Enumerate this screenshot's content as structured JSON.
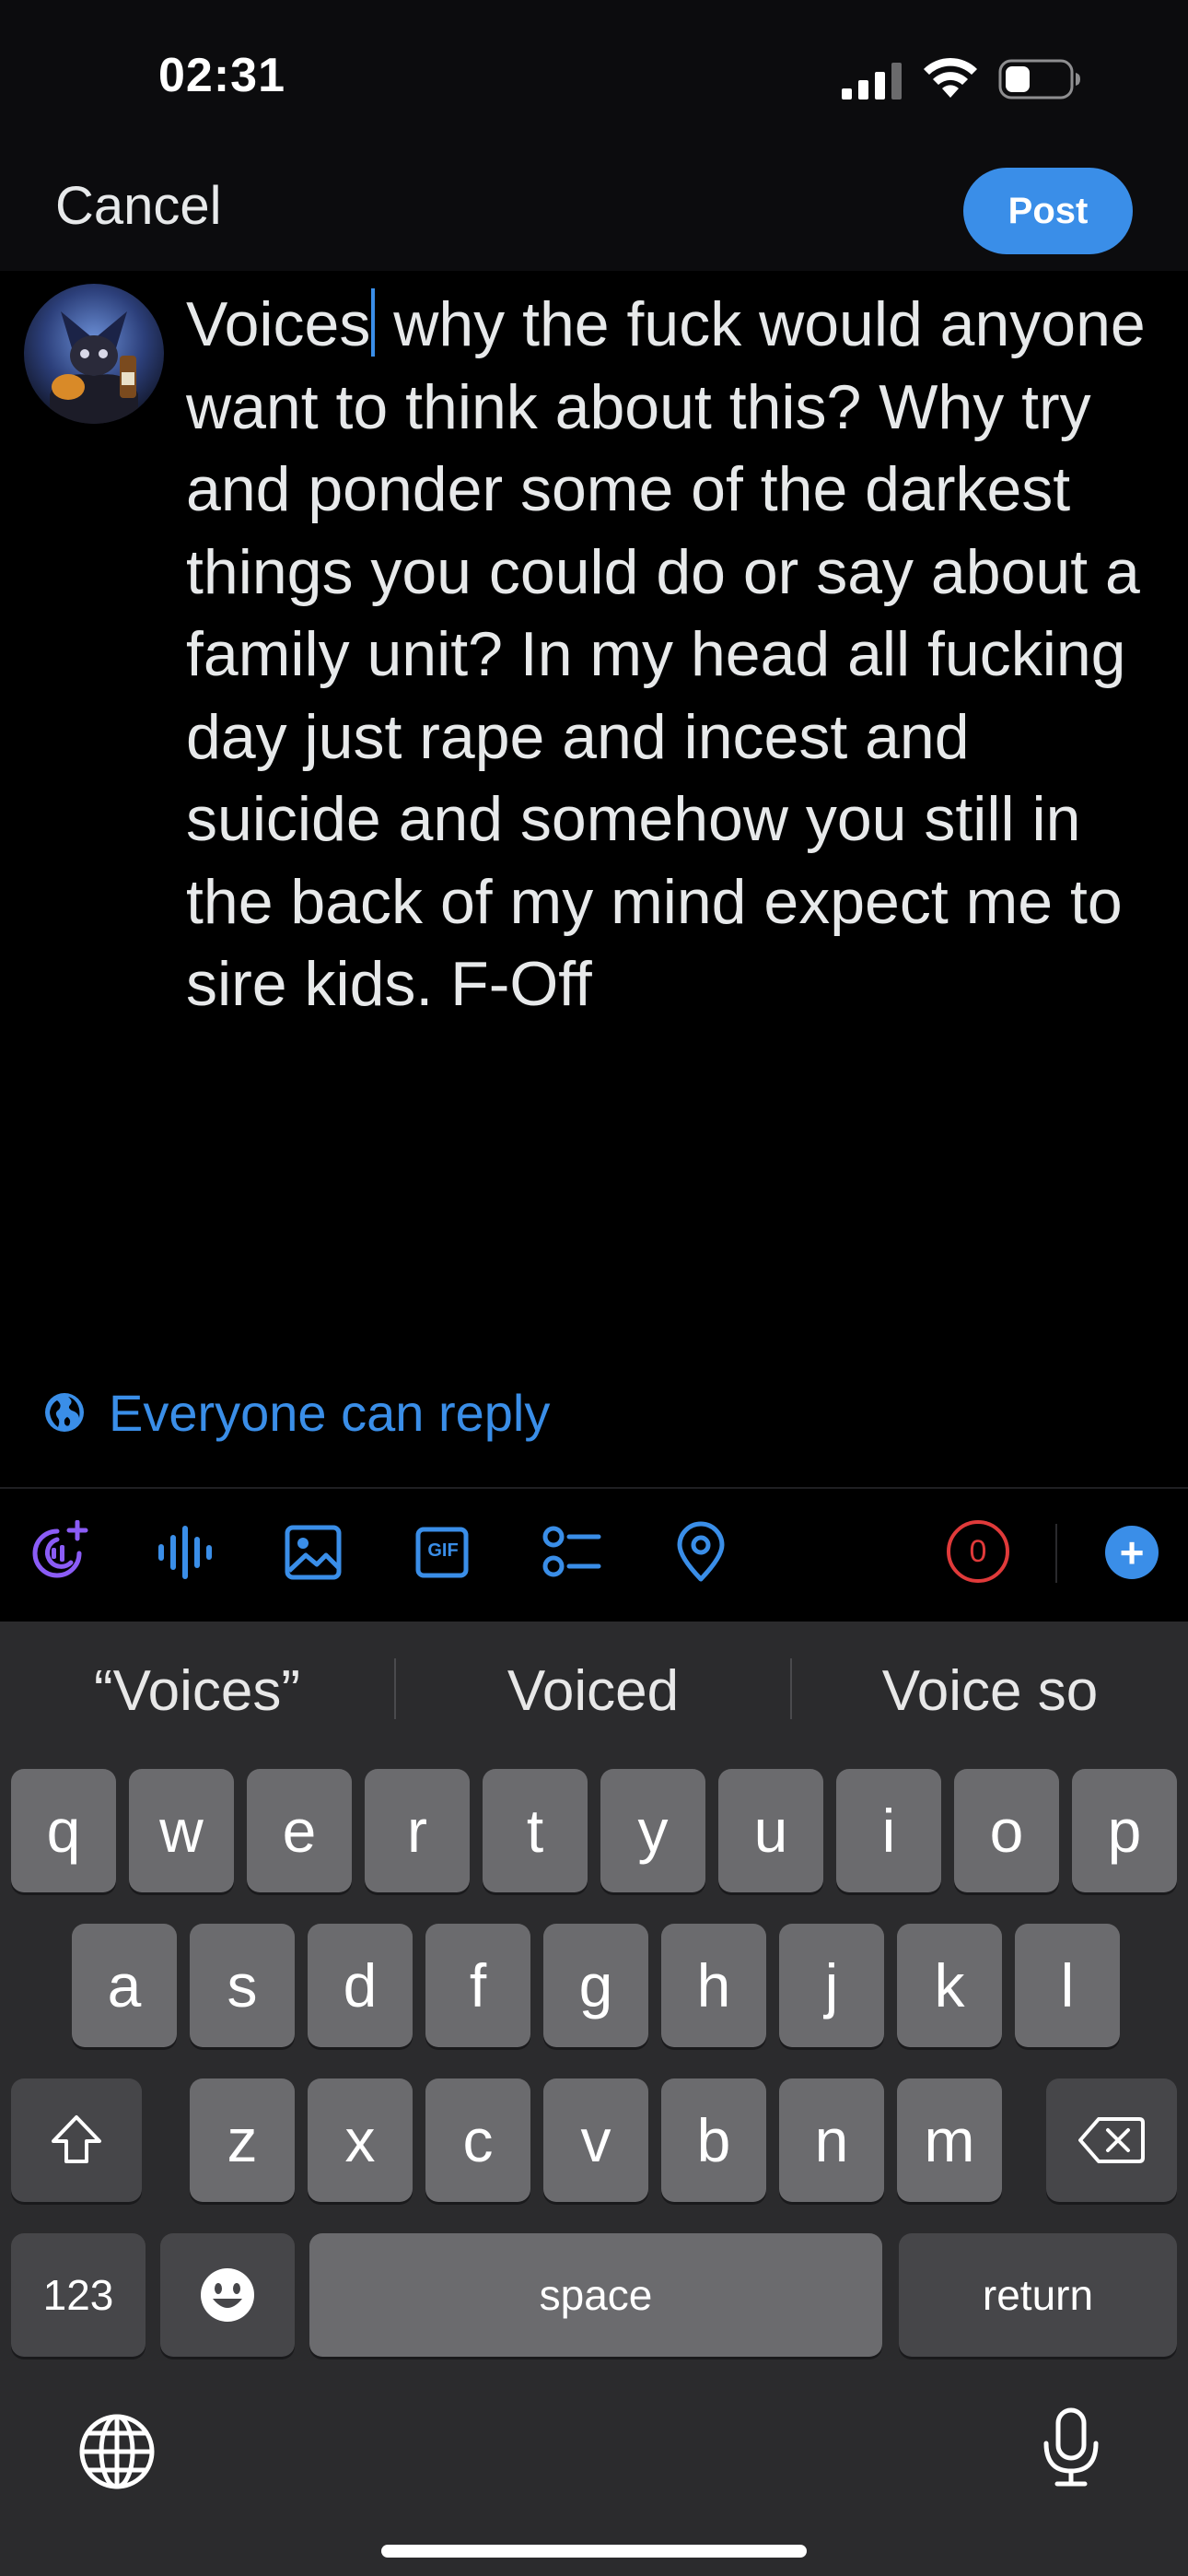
{
  "status_bar": {
    "time": "02:31"
  },
  "header": {
    "cancel_label": "Cancel",
    "post_label": "Post"
  },
  "compose": {
    "text_before_caret": "Voices",
    "text_after_caret": " why the fuck would anyone want to think about this? Why try and ponder some of the darkest things you could do or say about a family unit? In my head all fucking day just rape and incest and suicide and somehow you still in the back of my mind expect me to sire kids. F-Off"
  },
  "reply_setting": {
    "label": "Everyone can reply",
    "icon": "globe-icon"
  },
  "toolbar": {
    "icons": [
      "grok-icon",
      "voice-icon",
      "image-icon",
      "gif-icon",
      "poll-icon",
      "location-icon"
    ],
    "gif_label": "GIF",
    "char_counter": "0",
    "add_label": "+"
  },
  "colors": {
    "accent": "#3a8ee8",
    "counter": "#e03a3a",
    "grok": "#8b5cf6",
    "keyboard_bg": "#2b2b2d",
    "key": "#6b6b6e"
  },
  "keyboard": {
    "suggestions": [
      "“Voices”",
      "Voiced",
      "Voice so"
    ],
    "row1": [
      "q",
      "w",
      "e",
      "r",
      "t",
      "y",
      "u",
      "i",
      "o",
      "p"
    ],
    "row2": [
      "a",
      "s",
      "d",
      "f",
      "g",
      "h",
      "j",
      "k",
      "l"
    ],
    "row3": [
      "z",
      "x",
      "c",
      "v",
      "b",
      "n",
      "m"
    ],
    "numbers_label": "123",
    "space_label": "space",
    "return_label": "return"
  }
}
